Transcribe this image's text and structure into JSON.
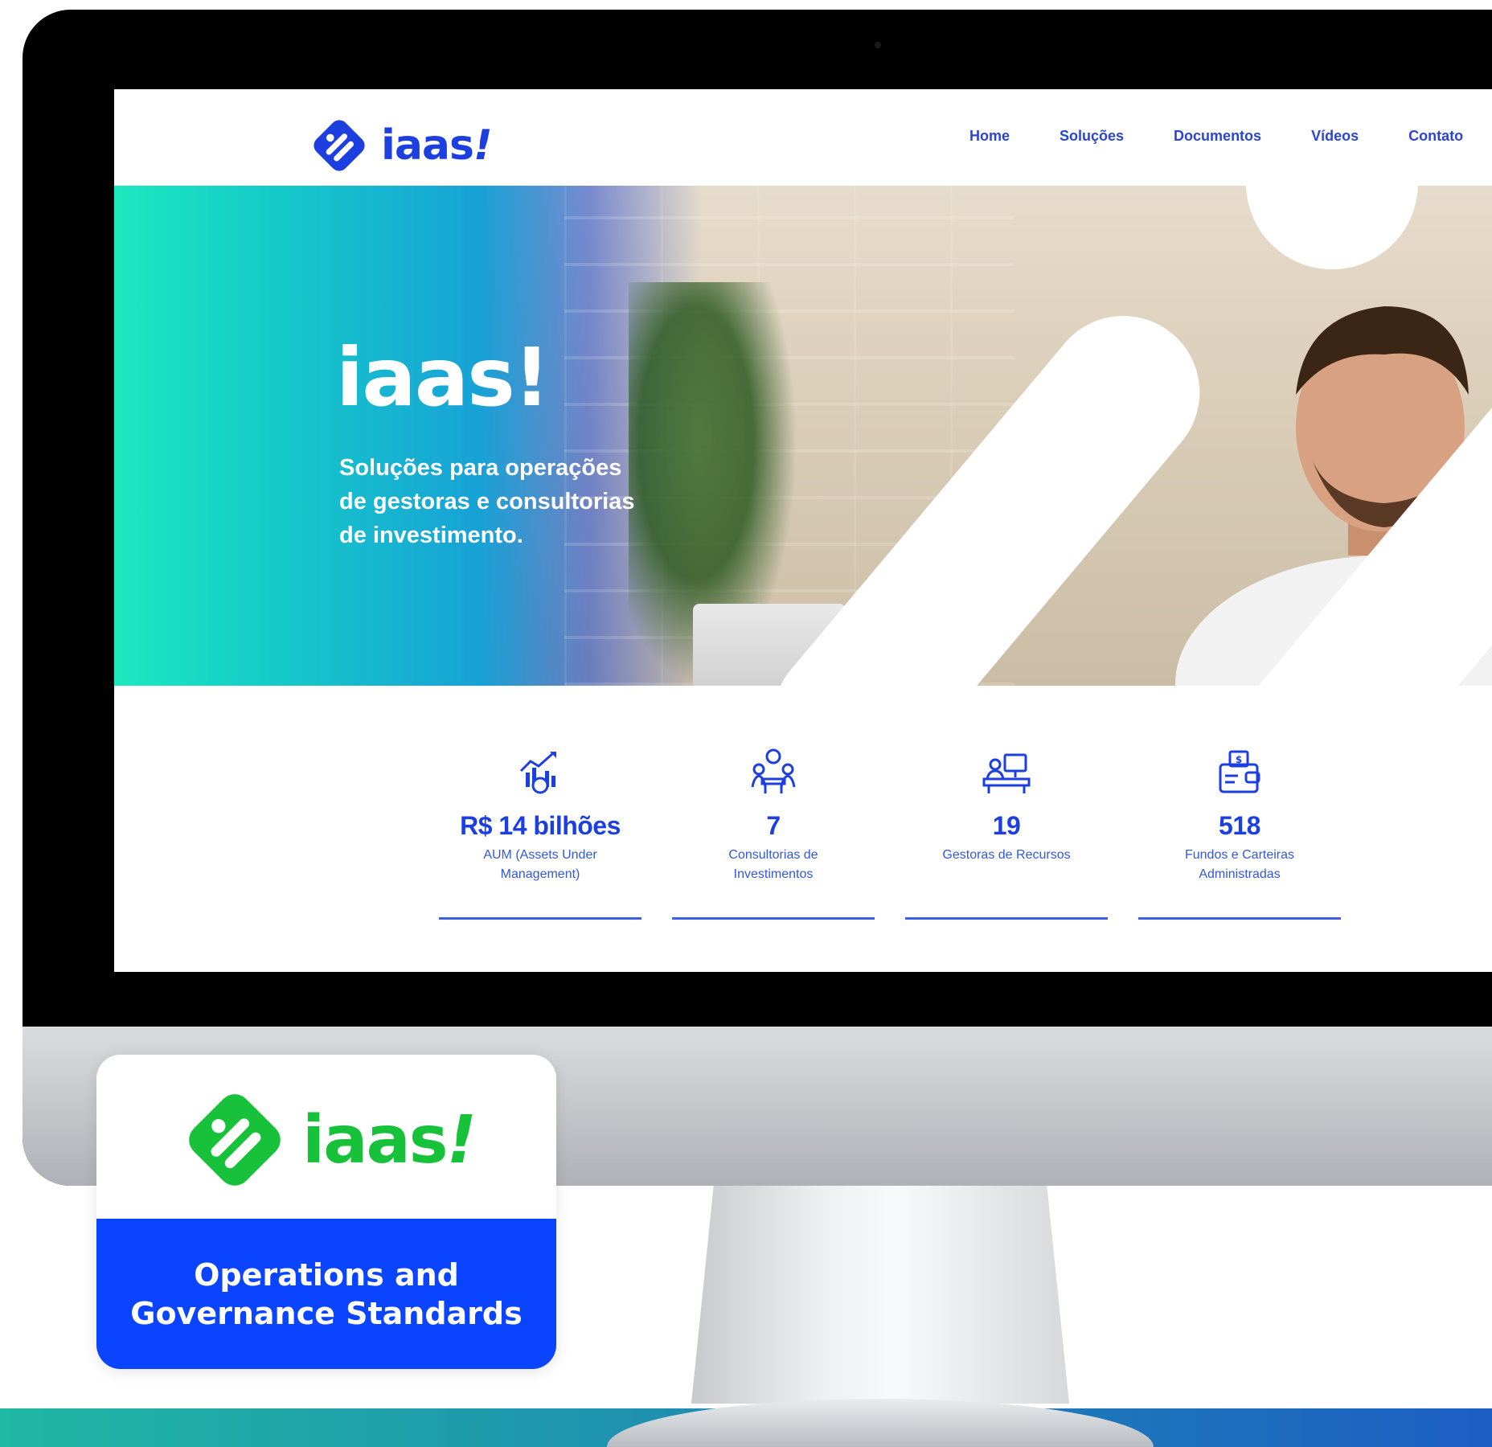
{
  "brand": {
    "name": "iaas",
    "exclamation": "!",
    "primary_color": "#1d3fe0",
    "green_color": "#17c23a",
    "card_blue": "#0b44ff"
  },
  "nav": {
    "items": [
      "Home",
      "Soluções",
      "Documentos",
      "Vídeos",
      "Contato"
    ]
  },
  "hero": {
    "title": "iaas!",
    "subtitle_lines": [
      "Soluções para operações",
      "de gestoras e consultorias",
      "de investimento."
    ]
  },
  "stats": [
    {
      "icon": "growth-chart-icon",
      "value": "R$ 14 bilhões",
      "label_lines": [
        "AUM (Assets Under",
        "Management)"
      ]
    },
    {
      "icon": "consulting-meeting-icon",
      "value": "7",
      "label_lines": [
        "Consultorias de",
        "Investimentos"
      ]
    },
    {
      "icon": "workstation-icon",
      "value": "19",
      "label_lines": [
        "Gestoras de Recursos"
      ]
    },
    {
      "icon": "wallet-icon",
      "value": "518",
      "label_lines": [
        "Fundos e Carteiras",
        "Administradas"
      ]
    }
  ],
  "card": {
    "logo_text": "iaas",
    "logo_exclamation": "!",
    "caption_lines": [
      "Operations and",
      "Governance Standards"
    ]
  }
}
